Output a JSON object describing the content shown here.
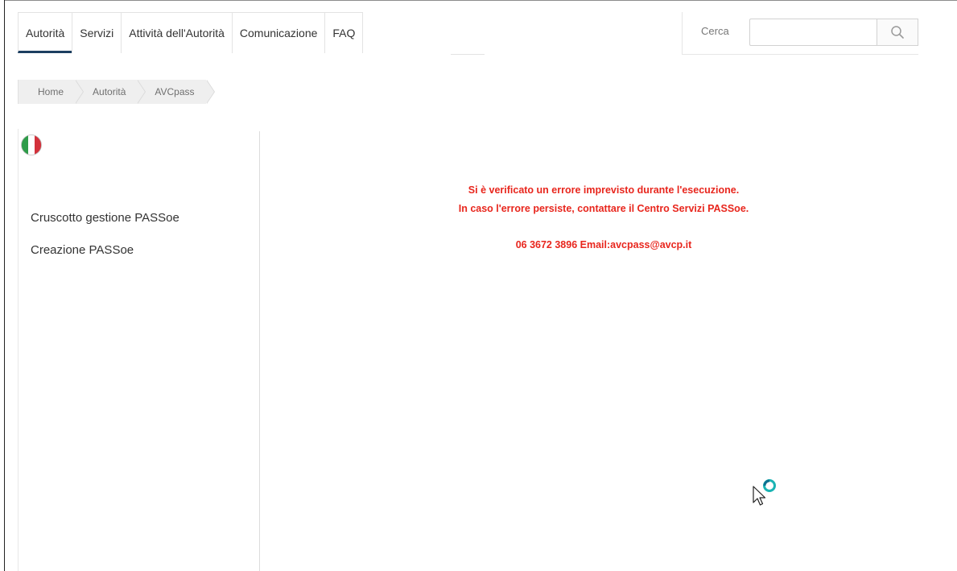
{
  "nav": {
    "tabs": [
      {
        "label": "Autorità",
        "active": true
      },
      {
        "label": "Servizi"
      },
      {
        "label": "Attività dell'Autorità"
      },
      {
        "label": "Comunicazione"
      },
      {
        "label": "FAQ"
      }
    ],
    "search": {
      "label": "Cerca",
      "value": "",
      "placeholder": ""
    }
  },
  "breadcrumb": [
    "Home",
    "Autorità",
    "AVCpass"
  ],
  "sidebar": {
    "items": [
      "Cruscotto gestione PASSoe",
      "Creazione PASSoe"
    ]
  },
  "error": {
    "line1": "Si è verificato un errore imprevisto durante l'esecuzione.",
    "line2": "In caso l'errore persiste, contattare il Centro Servizi PASSoe.",
    "contact": "06 3672 3896 Email:avcpass@avcp.it"
  },
  "colors": {
    "error_text": "#e8261d",
    "active_tab_underline": "#1c3f60",
    "flag_green": "#2e9c49",
    "flag_red": "#d3313b"
  }
}
